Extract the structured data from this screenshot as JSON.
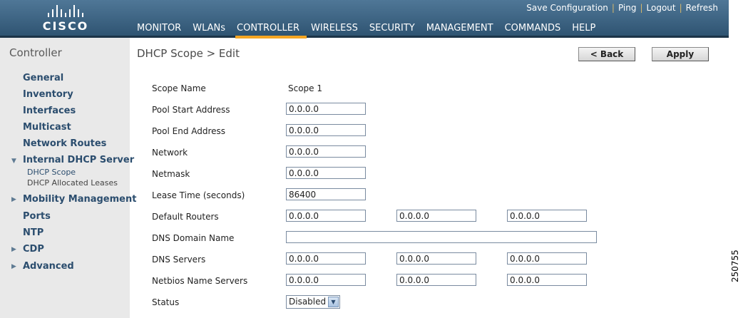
{
  "header": {
    "logo_text": "CISCO",
    "top_links": [
      "Save Configuration",
      "Ping",
      "Logout",
      "Refresh"
    ],
    "nav": [
      "MONITOR",
      "WLANs",
      "CONTROLLER",
      "WIRELESS",
      "SECURITY",
      "MANAGEMENT",
      "COMMANDS",
      "HELP"
    ],
    "active_nav": "CONTROLLER"
  },
  "sidebar": {
    "title": "Controller",
    "items": [
      "General",
      "Inventory",
      "Interfaces",
      "Multicast",
      "Network Routes",
      "Internal DHCP Server",
      "Mobility Management",
      "Ports",
      "NTP",
      "CDP",
      "Advanced"
    ],
    "subitems": [
      "DHCP Scope",
      "DHCP Allocated Leases"
    ]
  },
  "main": {
    "title": "DHCP Scope > Edit",
    "back_label": "< Back",
    "apply_label": "Apply",
    "scope_name_label": "Scope Name",
    "scope_name_value": "Scope 1",
    "pool_start_label": "Pool Start Address",
    "pool_start_value": "0.0.0.0",
    "pool_end_label": "Pool End Address",
    "pool_end_value": "0.0.0.0",
    "network_label": "Network",
    "network_value": "0.0.0.0",
    "netmask_label": "Netmask",
    "netmask_value": "0.0.0.0",
    "lease_label": "Lease Time (seconds)",
    "lease_value": "86400",
    "routers_label": "Default Routers",
    "routers_values": [
      "0.0.0.0",
      "0.0.0.0",
      "0.0.0.0"
    ],
    "dns_domain_label": "DNS Domain Name",
    "dns_domain_value": "",
    "dns_servers_label": "DNS Servers",
    "dns_servers_values": [
      "0.0.0.0",
      "0.0.0.0",
      "0.0.0.0"
    ],
    "netbios_label": "Netbios Name Servers",
    "netbios_values": [
      "0.0.0.0",
      "0.0.0.0",
      "0.0.0.0"
    ],
    "status_label": "Status",
    "status_value": "Disabled"
  },
  "figure_number": "250755"
}
